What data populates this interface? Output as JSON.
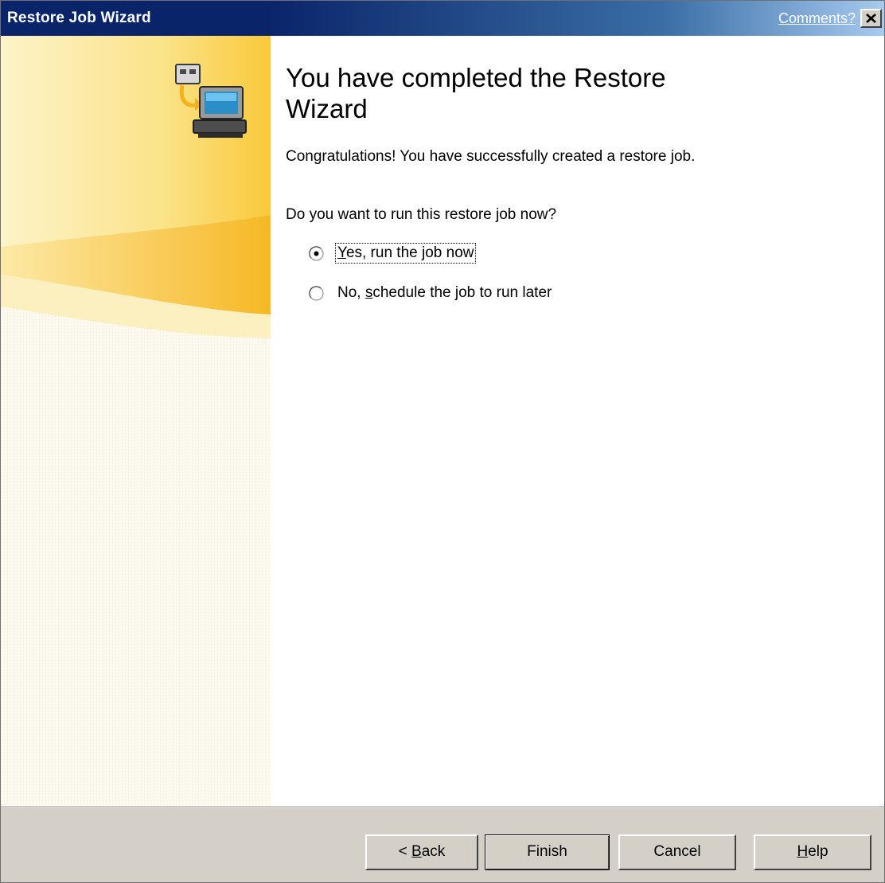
{
  "window": {
    "title": "Restore Job Wizard",
    "comments_link": "Comments?",
    "close_icon": "close-icon"
  },
  "side_panel": {
    "icon": "restore-computer-icon",
    "accent_color": "#f8c232"
  },
  "content": {
    "heading": "You have completed the Restore Wizard",
    "congrats": "Congratulations!  You have successfully created a restore job.",
    "question": "Do you want to run this restore job now?",
    "options": [
      {
        "label_pre": "",
        "label_mnemonic": "Y",
        "label_post": "es, run the job now",
        "selected": true
      },
      {
        "label_pre": "No, ",
        "label_mnemonic": "s",
        "label_post": "chedule the job to run later",
        "selected": false
      }
    ]
  },
  "buttons": {
    "back": {
      "pre": "< ",
      "mnemonic": "B",
      "post": "ack"
    },
    "finish": {
      "pre": "Finish",
      "mnemonic": "",
      "post": ""
    },
    "cancel": {
      "pre": "Cancel",
      "mnemonic": "",
      "post": ""
    },
    "help": {
      "pre": "",
      "mnemonic": "H",
      "post": "elp"
    }
  }
}
